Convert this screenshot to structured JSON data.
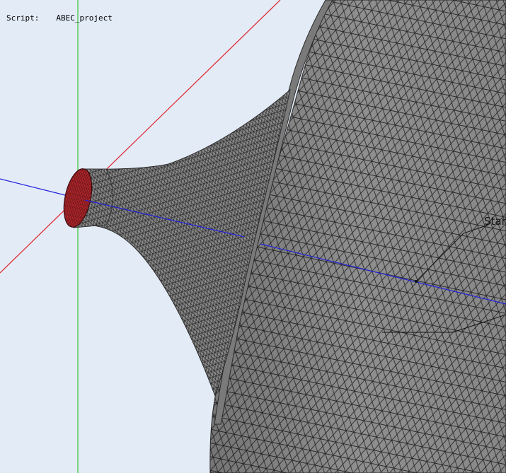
{
  "overlay": {
    "script_label": "Script:",
    "script_value": "ABEC_project"
  },
  "viewport": {
    "background": "#e3ebf7",
    "mesh_fill": "#8f8f8f",
    "mesh_edge": "#2b2b2b",
    "throat_fill": "#b3262b",
    "axis_colors": {
      "x": "#e0232a",
      "y": "#34c934",
      "z": "#2222dd"
    },
    "node_label": "Star"
  }
}
